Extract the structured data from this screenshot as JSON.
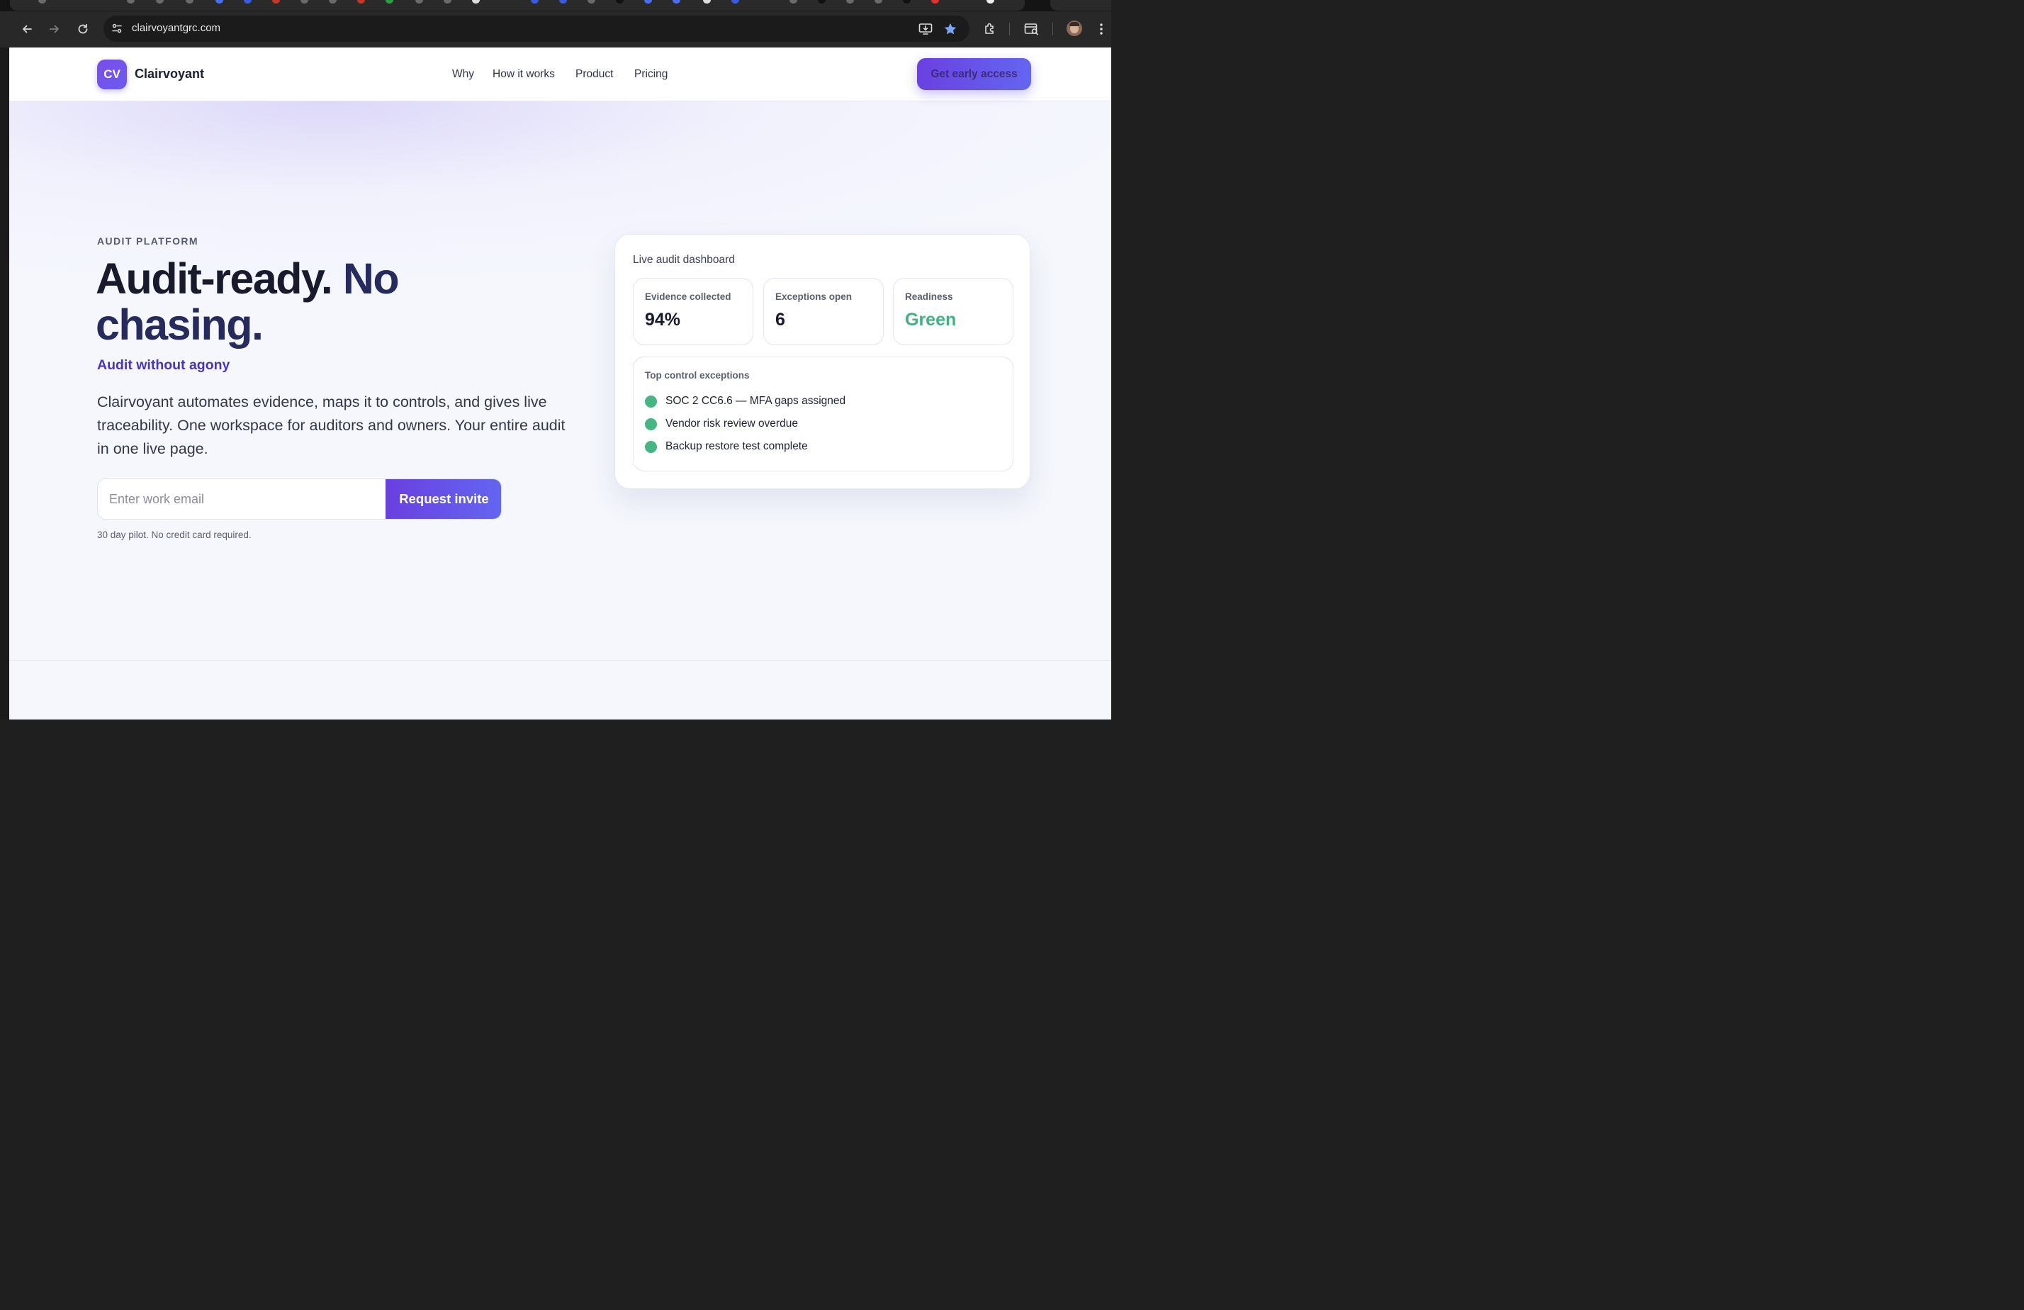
{
  "browser": {
    "url": "clairvoyantgrc.com"
  },
  "brand": {
    "logo_text": "CV",
    "name": "Clairvoyant",
    "accent_color": "#6b40e0",
    "accent_color_2": "#6366f1",
    "success_color": "#3fb27f"
  },
  "nav": {
    "items": [
      {
        "label": "Why"
      },
      {
        "label": "How it works"
      },
      {
        "label": "Product"
      },
      {
        "label": "Pricing"
      }
    ],
    "cta_label": "Get early access"
  },
  "hero": {
    "eyebrow": "AUDIT PLATFORM",
    "headline_part1": "Audit-ready.",
    "headline_part2": "No chasing.",
    "subhead": "Audit without agony",
    "lead": "Clairvoyant automates evidence, maps it to controls, and gives live traceability. One workspace for auditors and owners. Your entire audit in one live page.",
    "email_placeholder": "Enter work email",
    "email_value": "",
    "invite_label": "Request invite",
    "fineprint": "30 day pilot. No credit card required."
  },
  "dashboard": {
    "title": "Live audit dashboard",
    "stats": [
      {
        "label": "Evidence collected",
        "value": "94%"
      },
      {
        "label": "Exceptions open",
        "value": "6"
      },
      {
        "label": "Readiness",
        "value": "Green"
      }
    ],
    "exceptions_title": "Top control exceptions",
    "exceptions": [
      {
        "text": "SOC 2 CC6.6 — MFA gaps assigned"
      },
      {
        "text": "Vendor risk review overdue"
      },
      {
        "text": "Backup restore test complete"
      }
    ]
  },
  "icons": {
    "back": "arrow-left-icon",
    "forward": "arrow-right-icon",
    "reload": "reload-icon",
    "site_info": "tune-icon",
    "install": "install-app-icon",
    "bookmark": "star-icon",
    "extensions": "puzzle-icon",
    "search_tabs": "tab-search-icon",
    "menu": "kebab-menu-icon"
  }
}
